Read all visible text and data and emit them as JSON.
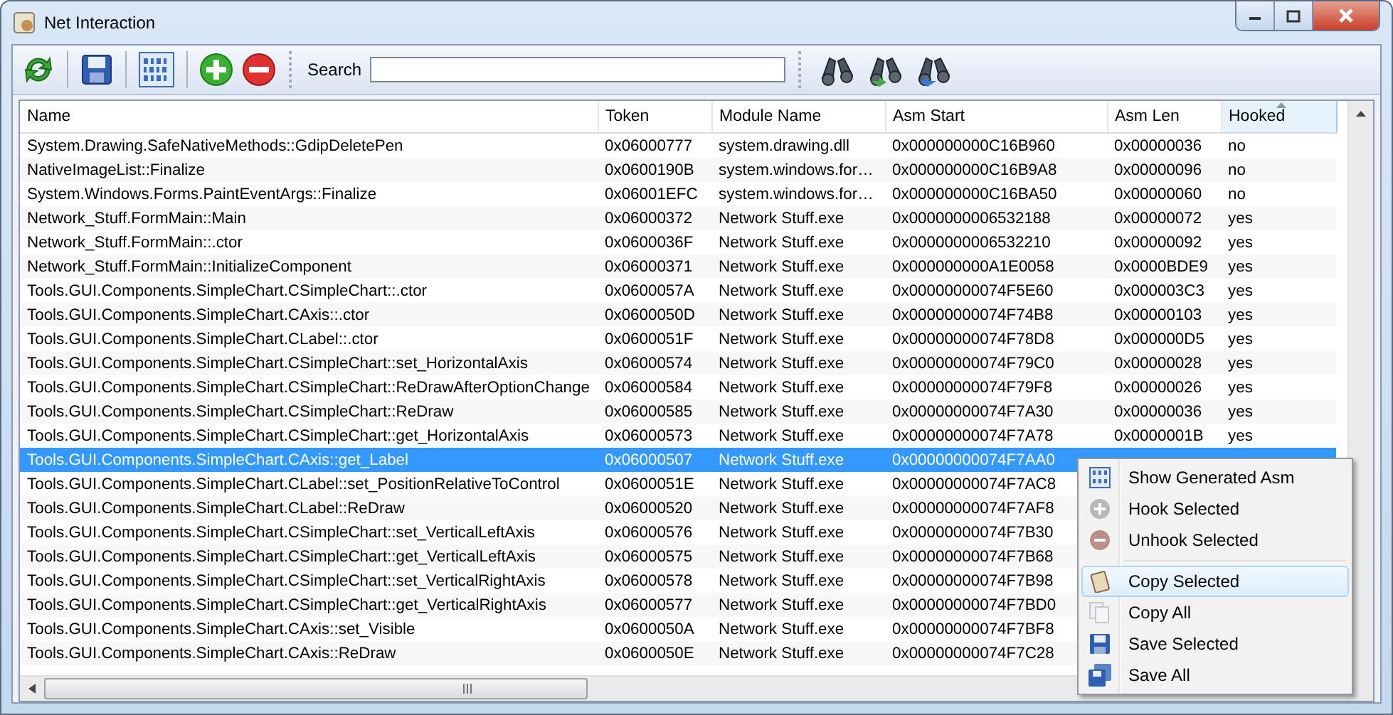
{
  "window": {
    "title": "Net Interaction"
  },
  "toolbar": {
    "search_label": "Search"
  },
  "table": {
    "columns": [
      {
        "label": "Name",
        "sorted": false
      },
      {
        "label": "Token",
        "sorted": false
      },
      {
        "label": "Module Name",
        "sorted": false
      },
      {
        "label": "Asm Start",
        "sorted": false
      },
      {
        "label": "Asm Len",
        "sorted": false
      },
      {
        "label": "Hooked",
        "sorted": true
      }
    ],
    "rows": [
      {
        "name": "System.Drawing.SafeNativeMethods::GdipDeletePen",
        "token": "0x06000777",
        "module": "system.drawing.dll",
        "asm_start": "0x000000000C16B960",
        "asm_len": "0x00000036",
        "hooked": "no",
        "selected": false
      },
      {
        "name": "NativeImageList::Finalize",
        "token": "0x0600190B",
        "module": "system.windows.for…",
        "asm_start": "0x000000000C16B9A8",
        "asm_len": "0x00000096",
        "hooked": "no",
        "selected": false
      },
      {
        "name": "System.Windows.Forms.PaintEventArgs::Finalize",
        "token": "0x06001EFC",
        "module": "system.windows.for…",
        "asm_start": "0x000000000C16BA50",
        "asm_len": "0x00000060",
        "hooked": "no",
        "selected": false
      },
      {
        "name": "Network_Stuff.FormMain::Main",
        "token": "0x06000372",
        "module": "Network Stuff.exe",
        "asm_start": "0x0000000006532188",
        "asm_len": "0x00000072",
        "hooked": "yes",
        "selected": false
      },
      {
        "name": "Network_Stuff.FormMain::.ctor",
        "token": "0x0600036F",
        "module": "Network Stuff.exe",
        "asm_start": "0x0000000006532210",
        "asm_len": "0x00000092",
        "hooked": "yes",
        "selected": false
      },
      {
        "name": "Network_Stuff.FormMain::InitializeComponent",
        "token": "0x06000371",
        "module": "Network Stuff.exe",
        "asm_start": "0x000000000A1E0058",
        "asm_len": "0x0000BDE9",
        "hooked": "yes",
        "selected": false
      },
      {
        "name": "Tools.GUI.Components.SimpleChart.CSimpleChart::.ctor",
        "token": "0x0600057A",
        "module": "Network Stuff.exe",
        "asm_start": "0x00000000074F5E60",
        "asm_len": "0x000003C3",
        "hooked": "yes",
        "selected": false
      },
      {
        "name": "Tools.GUI.Components.SimpleChart.CAxis::.ctor",
        "token": "0x0600050D",
        "module": "Network Stuff.exe",
        "asm_start": "0x00000000074F74B8",
        "asm_len": "0x00000103",
        "hooked": "yes",
        "selected": false
      },
      {
        "name": "Tools.GUI.Components.SimpleChart.CLabel::.ctor",
        "token": "0x0600051F",
        "module": "Network Stuff.exe",
        "asm_start": "0x00000000074F78D8",
        "asm_len": "0x000000D5",
        "hooked": "yes",
        "selected": false
      },
      {
        "name": "Tools.GUI.Components.SimpleChart.CSimpleChart::set_HorizontalAxis",
        "token": "0x06000574",
        "module": "Network Stuff.exe",
        "asm_start": "0x00000000074F79C0",
        "asm_len": "0x00000028",
        "hooked": "yes",
        "selected": false
      },
      {
        "name": "Tools.GUI.Components.SimpleChart.CSimpleChart::ReDrawAfterOptionChange",
        "token": "0x06000584",
        "module": "Network Stuff.exe",
        "asm_start": "0x00000000074F79F8",
        "asm_len": "0x00000026",
        "hooked": "yes",
        "selected": false
      },
      {
        "name": "Tools.GUI.Components.SimpleChart.CSimpleChart::ReDraw",
        "token": "0x06000585",
        "module": "Network Stuff.exe",
        "asm_start": "0x00000000074F7A30",
        "asm_len": "0x00000036",
        "hooked": "yes",
        "selected": false
      },
      {
        "name": "Tools.GUI.Components.SimpleChart.CSimpleChart::get_HorizontalAxis",
        "token": "0x06000573",
        "module": "Network Stuff.exe",
        "asm_start": "0x00000000074F7A78",
        "asm_len": "0x0000001B",
        "hooked": "yes",
        "selected": false
      },
      {
        "name": "Tools.GUI.Components.SimpleChart.CAxis::get_Label",
        "token": "0x06000507",
        "module": "Network Stuff.exe",
        "asm_start": "0x00000000074F7AA0",
        "selected": true
      },
      {
        "name": "Tools.GUI.Components.SimpleChart.CLabel::set_PositionRelativeToControl",
        "token": "0x0600051E",
        "module": "Network Stuff.exe",
        "asm_start": "0x00000000074F7AC8",
        "selected": false
      },
      {
        "name": "Tools.GUI.Components.SimpleChart.CLabel::ReDraw",
        "token": "0x06000520",
        "module": "Network Stuff.exe",
        "asm_start": "0x00000000074F7AF8",
        "selected": false
      },
      {
        "name": "Tools.GUI.Components.SimpleChart.CSimpleChart::set_VerticalLeftAxis",
        "token": "0x06000576",
        "module": "Network Stuff.exe",
        "asm_start": "0x00000000074F7B30",
        "selected": false
      },
      {
        "name": "Tools.GUI.Components.SimpleChart.CSimpleChart::get_VerticalLeftAxis",
        "token": "0x06000575",
        "module": "Network Stuff.exe",
        "asm_start": "0x00000000074F7B68",
        "selected": false
      },
      {
        "name": "Tools.GUI.Components.SimpleChart.CSimpleChart::set_VerticalRightAxis",
        "token": "0x06000578",
        "module": "Network Stuff.exe",
        "asm_start": "0x00000000074F7B98",
        "selected": false
      },
      {
        "name": "Tools.GUI.Components.SimpleChart.CSimpleChart::get_VerticalRightAxis",
        "token": "0x06000577",
        "module": "Network Stuff.exe",
        "asm_start": "0x00000000074F7BD0",
        "selected": false
      },
      {
        "name": "Tools.GUI.Components.SimpleChart.CAxis::set_Visible",
        "token": "0x0600050A",
        "module": "Network Stuff.exe",
        "asm_start": "0x00000000074F7BF8",
        "selected": false
      },
      {
        "name": "Tools.GUI.Components.SimpleChart.CAxis::ReDraw",
        "token": "0x0600050E",
        "module": "Network Stuff.exe",
        "asm_start": "0x00000000074F7C28",
        "selected": false
      }
    ]
  },
  "context_menu": {
    "groups": [
      [
        {
          "label": "Show Generated Asm",
          "selected": false
        },
        {
          "label": "Hook Selected",
          "selected": false
        },
        {
          "label": "Unhook Selected",
          "selected": false
        }
      ],
      [
        {
          "label": "Copy Selected",
          "selected": true
        },
        {
          "label": "Copy All",
          "selected": false
        },
        {
          "label": "Save Selected",
          "selected": false
        },
        {
          "label": "Save All",
          "selected": false
        }
      ]
    ]
  }
}
